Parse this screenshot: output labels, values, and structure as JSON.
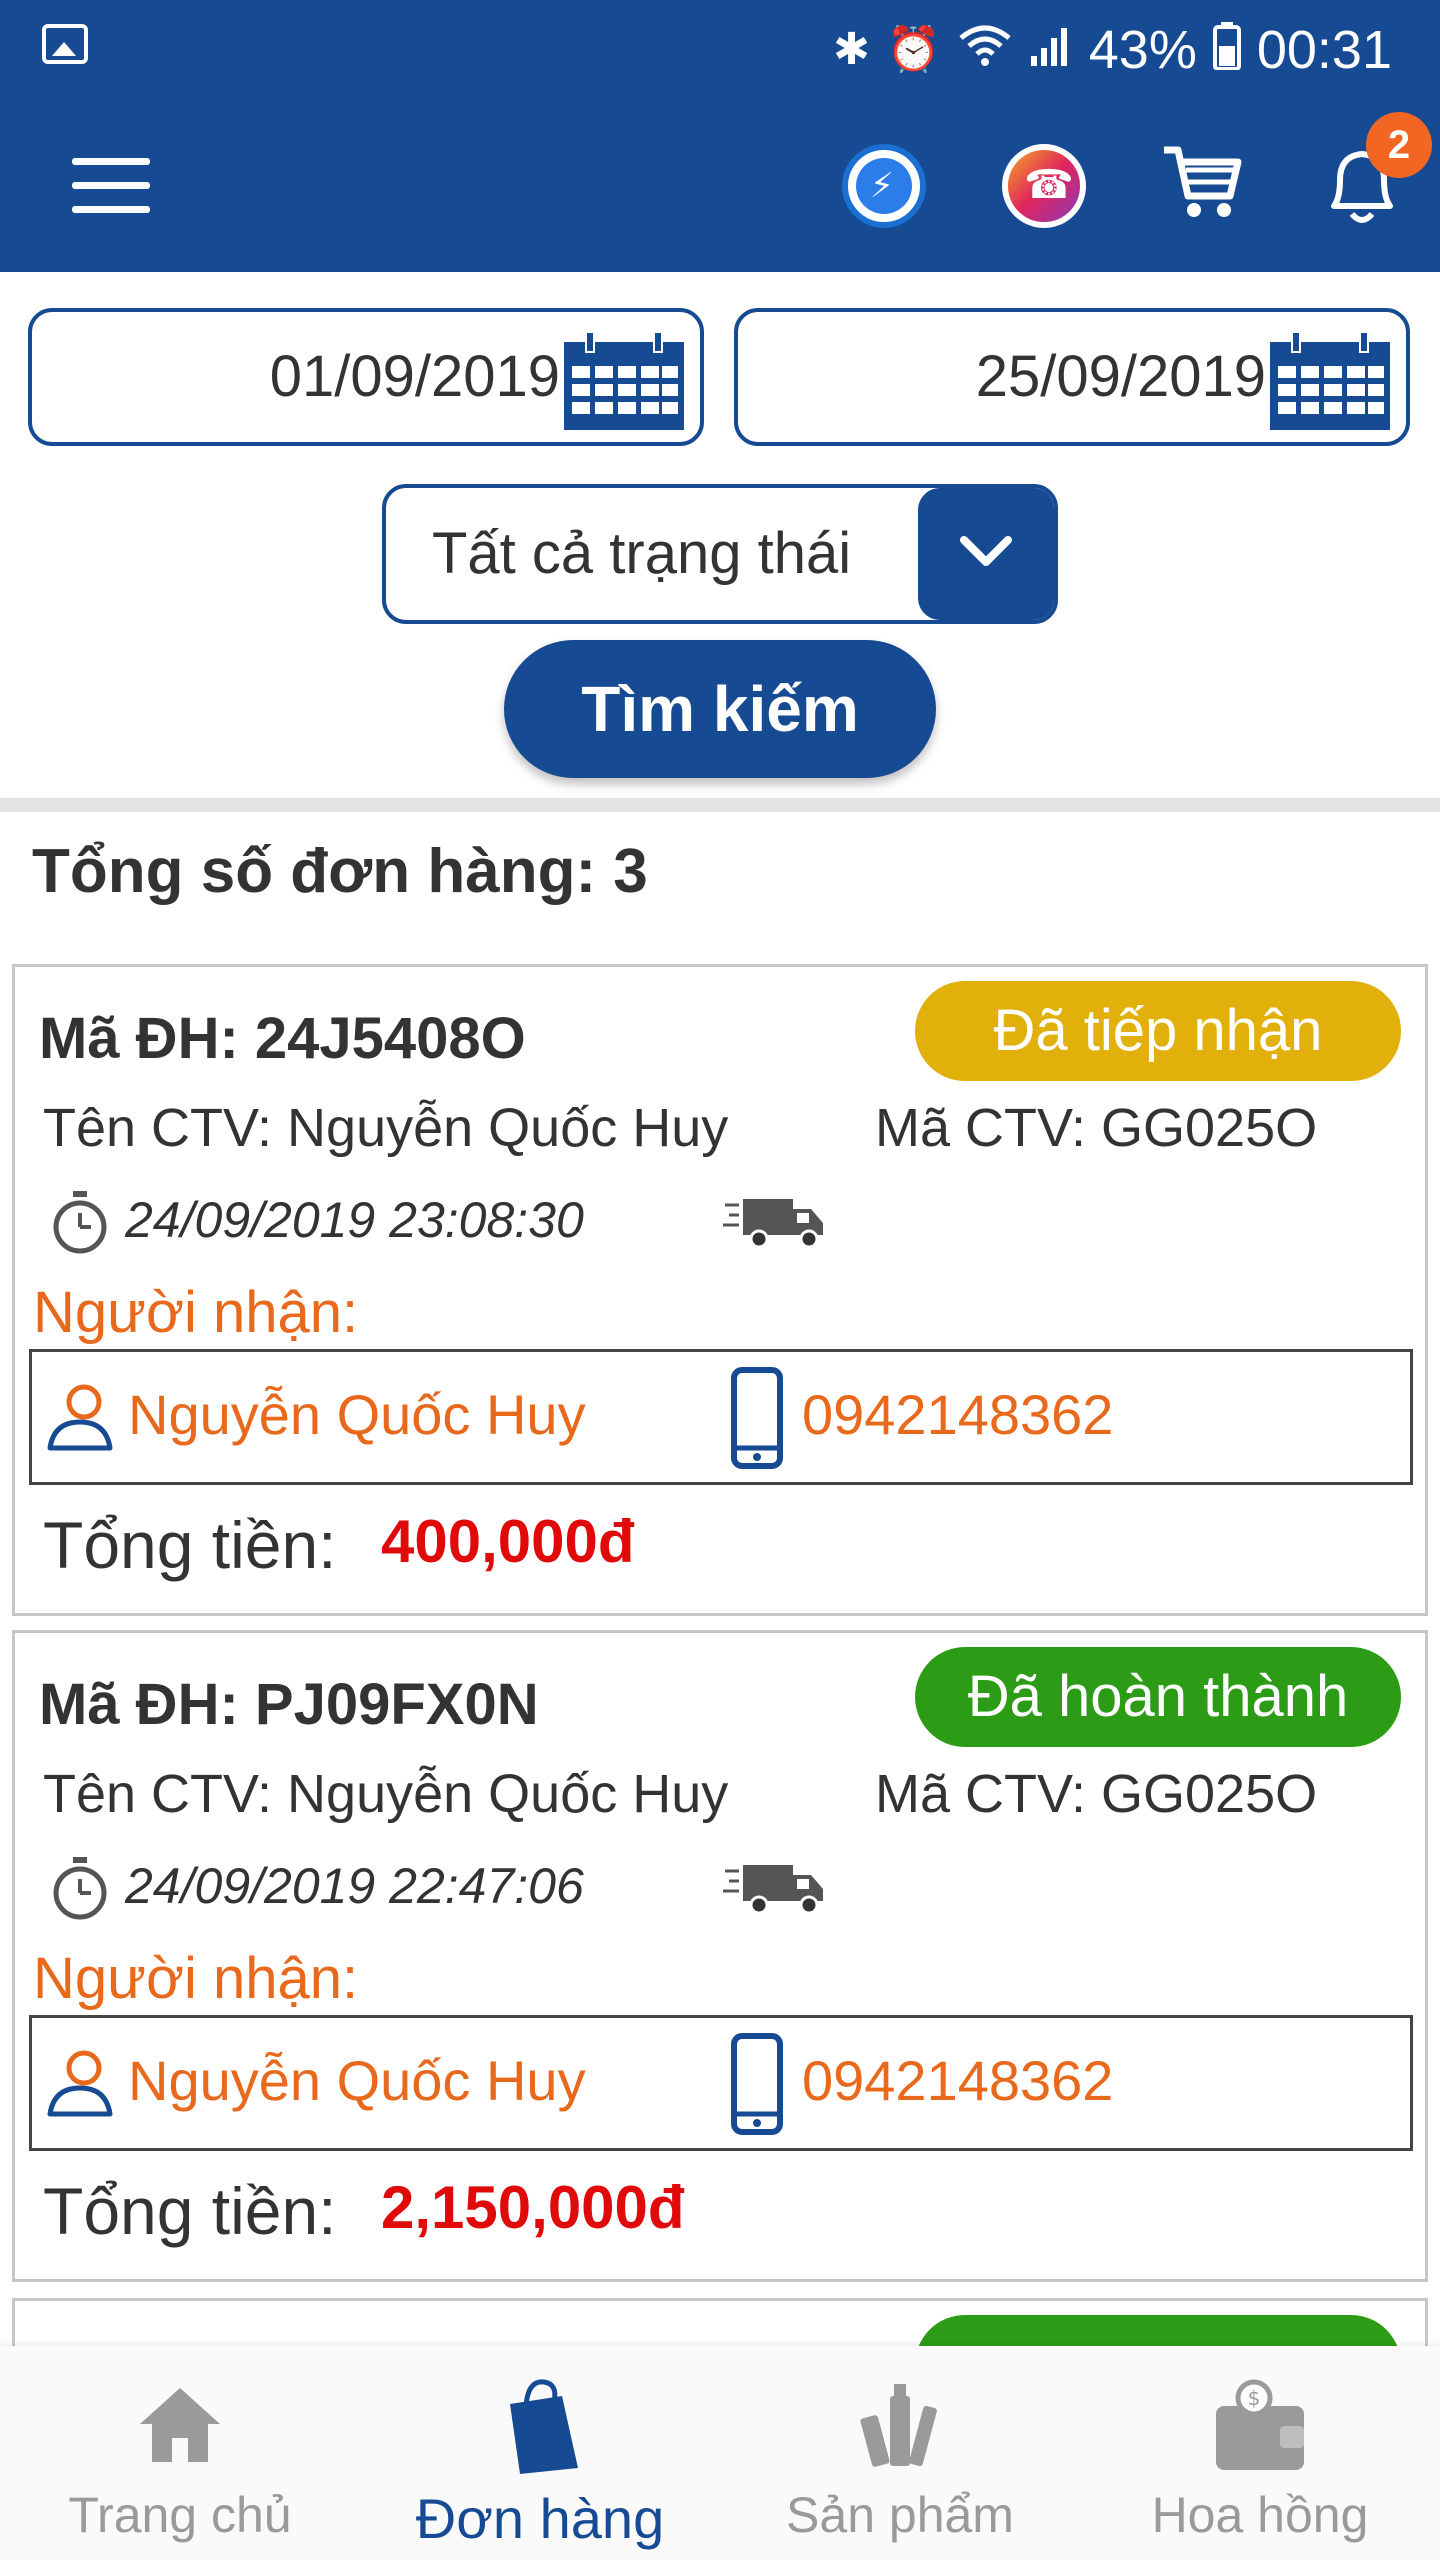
{
  "status_bar": {
    "battery": "43%",
    "time": "00:31"
  },
  "app_bar": {
    "notification_count": "2"
  },
  "filters": {
    "date_from": "01/09/2019",
    "date_to": "25/09/2019",
    "status_selected": "Tất cả trạng thái",
    "search_label": "Tìm kiếm"
  },
  "summary": {
    "total_orders": "Tổng số đơn hàng: 3"
  },
  "orders": [
    {
      "order_id": "Mã ĐH: 24J5408O",
      "status": "Đã tiếp nhận",
      "status_color": "#e2b00b",
      "ctv_name": "Tên CTV: Nguyễn Quốc Huy",
      "ctv_code": "Mã CTV: GG025O",
      "datetime": "24/09/2019 23:08:30",
      "recipient_label": "Người nhận:",
      "recipient_name": "Nguyễn Quốc Huy",
      "recipient_phone": "0942148362",
      "total_label": "Tổng tiền:",
      "total_value": "400,000đ"
    },
    {
      "order_id": "Mã ĐH: PJ09FX0N",
      "status": "Đã hoàn thành",
      "status_color": "#2c9b16",
      "ctv_name": "Tên CTV: Nguyễn Quốc Huy",
      "ctv_code": "Mã CTV: GG025O",
      "datetime": "24/09/2019 22:47:06",
      "recipient_label": "Người nhận:",
      "recipient_name": "Nguyễn Quốc Huy",
      "recipient_phone": "0942148362",
      "total_label": "Tổng tiền:",
      "total_value": "2,150,000đ"
    },
    {
      "status_color": "#2c9b16"
    }
  ],
  "bottom_nav": [
    {
      "label": "Trang chủ",
      "icon": "home-icon",
      "active": false
    },
    {
      "label": "Đơn hàng",
      "icon": "shopping-bag-icon",
      "active": true
    },
    {
      "label": "Sản phẩm",
      "icon": "cosmetics-icon",
      "active": false
    },
    {
      "label": "Hoa hồng",
      "icon": "wallet-icon",
      "active": false
    }
  ],
  "colors": {
    "primary": "#164a92",
    "accent_orange": "#e8681c",
    "price_red": "#e00a0a"
  }
}
